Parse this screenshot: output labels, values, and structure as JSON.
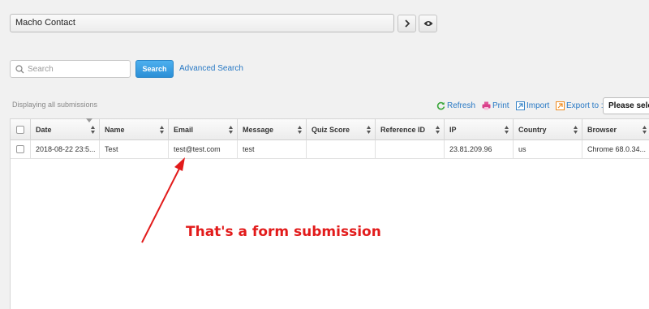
{
  "form_selector": {
    "value": "Macho Contact"
  },
  "search": {
    "placeholder": "Search",
    "button_label": "Search",
    "advanced_label": "Advanced Search"
  },
  "status_text": "Displaying all submissions",
  "toolbar": {
    "refresh_label": "Refresh",
    "print_label": "Print",
    "import_label": "Import",
    "export_label": "Export to :",
    "export_select_value": "Please select"
  },
  "table": {
    "columns": [
      "Date",
      "Name",
      "Email",
      "Message",
      "Quiz Score",
      "Reference ID",
      "IP",
      "Country",
      "Browser"
    ],
    "rows": [
      [
        "2018-08-22 23:5...",
        "Test",
        "test@test.com",
        "test",
        "",
        "",
        "23.81.209.96",
        "us",
        "Chrome 68.0.34..."
      ]
    ]
  },
  "annotation": {
    "text": "That's a form submission",
    "color": "#e21b1b"
  },
  "colors": {
    "accent": "#2b8fd6",
    "link": "#2778c4"
  }
}
